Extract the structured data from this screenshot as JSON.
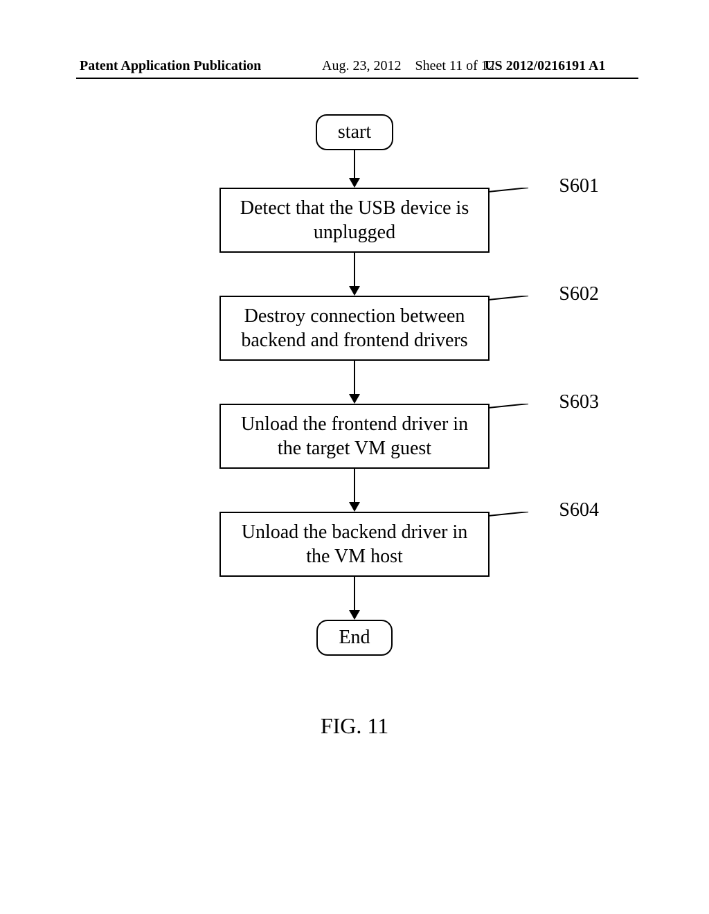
{
  "header": {
    "left": "Patent Application Publication",
    "date": "Aug. 23, 2012",
    "sheet": "Sheet 11 of 12",
    "pubnum": "US 2012/0216191 A1"
  },
  "flow": {
    "start": "start",
    "steps": [
      {
        "label": "S601",
        "text": "Detect that the USB device is unplugged"
      },
      {
        "label": "S602",
        "text": "Destroy connection between backend and frontend drivers"
      },
      {
        "label": "S603",
        "text": "Unload the frontend driver in the target VM guest"
      },
      {
        "label": "S604",
        "text": "Unload the backend driver in the VM host"
      }
    ],
    "end": "End"
  },
  "figure_caption": "FIG. 11",
  "chart_data": {
    "type": "flowchart",
    "nodes": [
      {
        "id": "start",
        "shape": "terminator",
        "text": "start"
      },
      {
        "id": "S601",
        "shape": "process",
        "text": "Detect that the USB device is unplugged"
      },
      {
        "id": "S602",
        "shape": "process",
        "text": "Destroy connection between backend and frontend drivers"
      },
      {
        "id": "S603",
        "shape": "process",
        "text": "Unload the frontend driver in the target VM guest"
      },
      {
        "id": "S604",
        "shape": "process",
        "text": "Unload the backend driver in the VM host"
      },
      {
        "id": "end",
        "shape": "terminator",
        "text": "End"
      }
    ],
    "edges": [
      {
        "from": "start",
        "to": "S601"
      },
      {
        "from": "S601",
        "to": "S602"
      },
      {
        "from": "S602",
        "to": "S603"
      },
      {
        "from": "S603",
        "to": "S604"
      },
      {
        "from": "S604",
        "to": "end"
      }
    ]
  }
}
